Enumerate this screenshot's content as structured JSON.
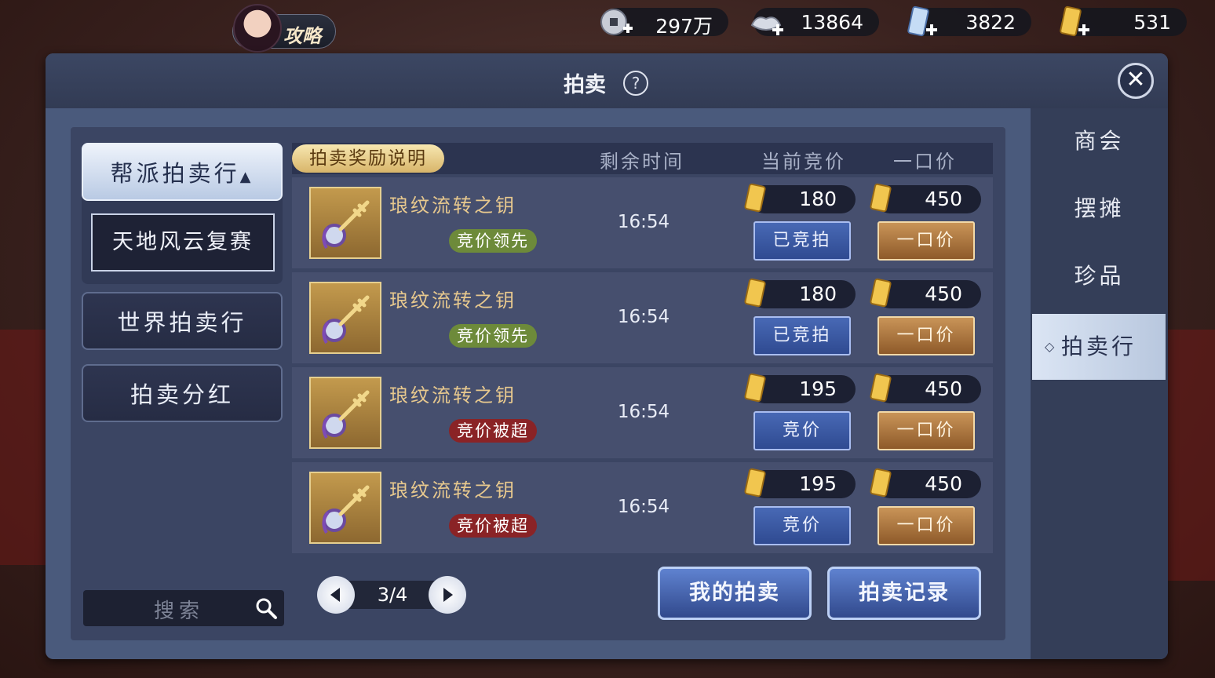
{
  "top_bar": {
    "guide_label": "攻略",
    "currencies": [
      {
        "icon": "copper-coin-icon",
        "value": "297万"
      },
      {
        "icon": "silver-ingot-icon",
        "value": "13864"
      },
      {
        "icon": "blue-ticket-icon",
        "value": "3822"
      },
      {
        "icon": "gold-ticket-icon",
        "value": "531"
      }
    ]
  },
  "window": {
    "title": "拍卖",
    "help": "?",
    "close": "✕"
  },
  "side_tabs": [
    {
      "label": "商会"
    },
    {
      "label": "摆摊"
    },
    {
      "label": "珍品"
    },
    {
      "label": "拍卖行",
      "active": true
    }
  ],
  "categories": {
    "guild_auction": "帮派拍卖行",
    "guild_sub": "天地风云复赛",
    "world_auction": "世界拍卖行",
    "dividend": "拍卖分红"
  },
  "search": {
    "placeholder": "搜索"
  },
  "table": {
    "reward_tag": "拍卖奖励说明",
    "headers": {
      "time": "剩余时间",
      "current_bid": "当前竞价",
      "buyout": "一口价"
    },
    "rows": [
      {
        "name": "琅纹流转之钥",
        "status": "竞价领先",
        "status_type": "lead",
        "time": "16:54",
        "bid": "180",
        "buyout": "450",
        "bid_button": "已竞拍",
        "buy_button": "一口价"
      },
      {
        "name": "琅纹流转之钥",
        "status": "竞价领先",
        "status_type": "lead",
        "time": "16:54",
        "bid": "180",
        "buyout": "450",
        "bid_button": "已竞拍",
        "buy_button": "一口价"
      },
      {
        "name": "琅纹流转之钥",
        "status": "竞价被超",
        "status_type": "over",
        "time": "16:54",
        "bid": "195",
        "buyout": "450",
        "bid_button": "竞价",
        "buy_button": "一口价"
      },
      {
        "name": "琅纹流转之钥",
        "status": "竞价被超",
        "status_type": "over",
        "time": "16:54",
        "bid": "195",
        "buyout": "450",
        "bid_button": "竞价",
        "buy_button": "一口价"
      }
    ]
  },
  "pager": {
    "text": "3/4"
  },
  "actions": {
    "my_auction": "我的拍卖",
    "auction_log": "拍卖记录"
  }
}
